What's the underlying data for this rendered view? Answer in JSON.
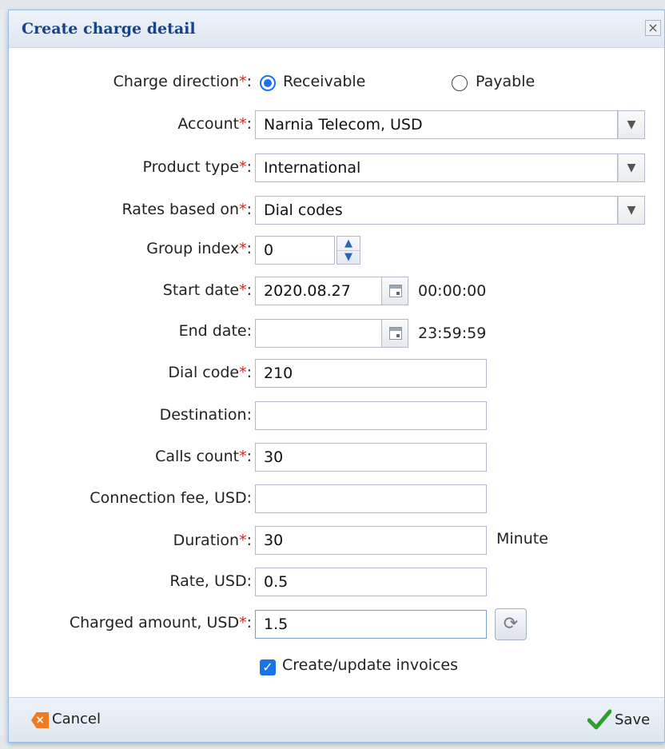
{
  "dialog": {
    "title": "Create charge detail",
    "close_glyph": "×"
  },
  "form": {
    "charge_direction": {
      "label": "Charge direction",
      "options": [
        "Receivable",
        "Payable"
      ],
      "selected": "Receivable"
    },
    "account": {
      "label": "Account",
      "value": "Narnia Telecom, USD"
    },
    "product_type": {
      "label": "Product type",
      "value": "International"
    },
    "rates_based_on": {
      "label": "Rates based on",
      "value": "Dial codes"
    },
    "group_index": {
      "label": "Group index",
      "value": "0"
    },
    "start_date": {
      "label": "Start date",
      "value": "2020.08.27",
      "time": "00:00:00"
    },
    "end_date": {
      "label": "End date",
      "value": "",
      "time": "23:59:59"
    },
    "dial_code": {
      "label": "Dial code",
      "value": "210"
    },
    "destination": {
      "label": "Destination",
      "value": ""
    },
    "calls_count": {
      "label": "Calls count",
      "value": "30"
    },
    "connection_fee": {
      "label": "Connection fee, USD",
      "value": ""
    },
    "duration": {
      "label": "Duration",
      "value": "30",
      "unit": "Minute"
    },
    "rate": {
      "label": "Rate, USD",
      "value": "0.5"
    },
    "charged_amount": {
      "label": "Charged amount, USD",
      "value": "1.5"
    },
    "create_invoices": {
      "label": "Create/update invoices",
      "checked": true
    },
    "required_mark": "*",
    "colon": ":"
  },
  "footer": {
    "cancel_label": "Cancel",
    "save_label": "Save"
  },
  "colors": {
    "accent": "#1a73e8",
    "required": "#e02020",
    "title": "#15428b",
    "save_check": "#2e9e2e",
    "cancel_icon": "#f07a22"
  }
}
